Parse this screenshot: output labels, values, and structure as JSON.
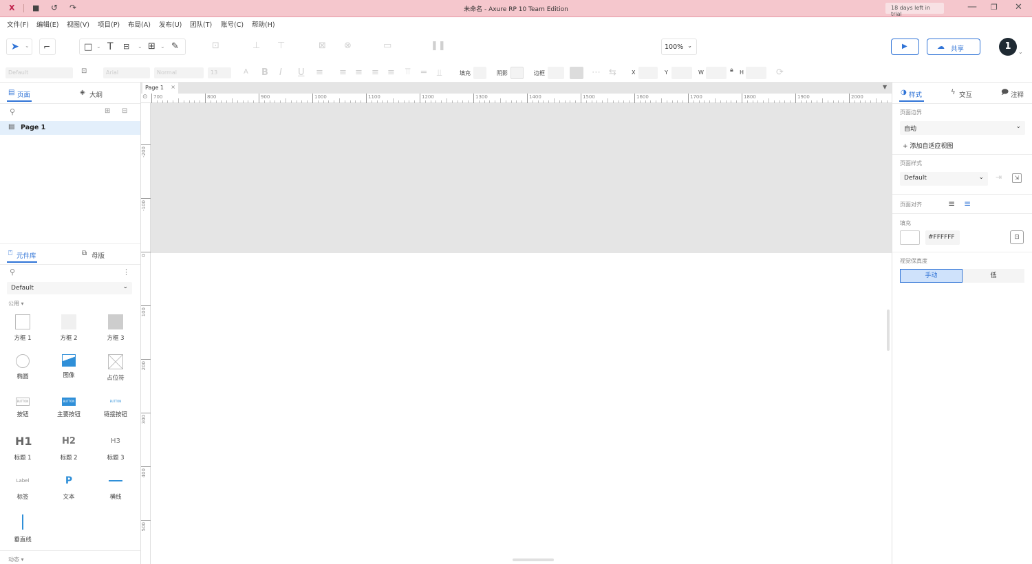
{
  "window": {
    "app_icon": "X",
    "title": "未命名 - Axure RP 10 Team Edition",
    "trial": "18 days left in trial"
  },
  "menu": [
    "文件(F)",
    "编辑(E)",
    "视图(V)",
    "项目(P)",
    "布局(A)",
    "发布(U)",
    "团队(T)",
    "账号(C)",
    "帮助(H)"
  ],
  "toolbar": {
    "zoom": "100%",
    "share_label": "共享",
    "avatar_initial": "1"
  },
  "formatbar": {
    "style_select": "Default",
    "font": "Arial",
    "font_style": "Normal",
    "font_size": "13",
    "fill_label": "填充",
    "shadow_label": "阴影",
    "border_label": "边框",
    "x_label": "X",
    "y_label": "Y",
    "w_label": "W",
    "h_label": "H"
  },
  "left_panel": {
    "tabs": [
      "页面",
      "大纲"
    ],
    "page_item": "Page 1",
    "lib_tabs": [
      "元件库",
      "母版"
    ],
    "lib_select": "Default",
    "section_label": "公用 ▾",
    "bottom_section": "动态 ▾",
    "items": [
      {
        "label": "方框 1",
        "icon": "box-outline"
      },
      {
        "label": "方框 2",
        "icon": "box-light"
      },
      {
        "label": "方框 3",
        "icon": "box-gray"
      },
      {
        "label": "椭圆",
        "icon": "ellipse"
      },
      {
        "label": "图像",
        "icon": "image"
      },
      {
        "label": "占位符",
        "icon": "placeholder"
      },
      {
        "label": "按钮",
        "icon": "button",
        "icon_text": "BUTTON"
      },
      {
        "label": "主要按钮",
        "icon": "primary-button",
        "icon_text": "BUTTON"
      },
      {
        "label": "链接按钮",
        "icon": "link-button",
        "icon_text": "BUTTON"
      },
      {
        "label": "标题 1",
        "icon": "h1",
        "icon_text": "H1"
      },
      {
        "label": "标题 2",
        "icon": "h2",
        "icon_text": "H2"
      },
      {
        "label": "标题 3",
        "icon": "h3",
        "icon_text": "H3"
      },
      {
        "label": "标签",
        "icon": "label",
        "icon_text": "Label"
      },
      {
        "label": "文本",
        "icon": "paragraph",
        "icon_text": "P"
      },
      {
        "label": "横线",
        "icon": "horizontal-line"
      },
      {
        "label": "垂直线",
        "icon": "vertical-line"
      }
    ]
  },
  "canvas": {
    "page_tab": "Page 1",
    "ruler_h": [
      "700",
      "800",
      "900",
      "1000",
      "1100",
      "1200",
      "1300",
      "1400",
      "1500",
      "1600",
      "1700",
      "1800",
      "1900",
      "2000"
    ],
    "ruler_v": [
      "-200",
      "-100",
      "0",
      "100",
      "200",
      "300",
      "400",
      "500"
    ]
  },
  "right_panel": {
    "tabs": [
      "样式",
      "交互",
      "注释"
    ],
    "page_dims_label": "页面边界",
    "page_dims_value": "自动",
    "add_adaptive": "添加自适应视图",
    "page_style_label": "页面样式",
    "page_style_value": "Default",
    "page_align_label": "页面对齐",
    "fill_label": "填充",
    "fill_value": "#FFFFFF",
    "quality_label": "视觉保真度",
    "quality_options": [
      "手动",
      "低"
    ]
  },
  "colors": {
    "titlebar": "#f5c7cd",
    "accent": "#2f73d6",
    "canvas_gray": "#e5e5e5"
  }
}
